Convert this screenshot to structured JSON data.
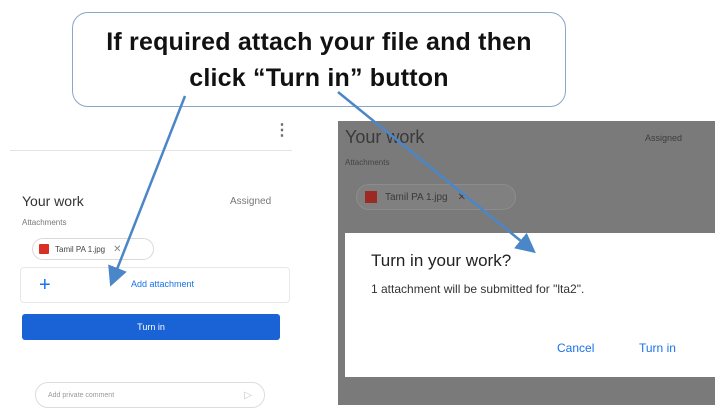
{
  "callout": {
    "line1": "If required attach your file and then",
    "line2": "click “Turn in” button"
  },
  "left": {
    "menu_icon": "⋮",
    "your_work": "Your work",
    "status": "Assigned",
    "attachments_label": "Attachments",
    "file_name": "Tamil PA 1.jpg",
    "add_plus": "+",
    "add_attachment": "Add attachment",
    "turn_in": "Turn in",
    "comment_placeholder": "Add private comment"
  },
  "right": {
    "your_work": "Your work",
    "status": "Assigned",
    "attachments_label": "Attachments",
    "file_name": "Tamil PA 1.jpg",
    "dialog": {
      "title": "Turn in your work?",
      "body": "1 attachment will be submitted for \"lta2\".",
      "cancel": "Cancel",
      "turn_in": "Turn in"
    }
  },
  "colors": {
    "accent": "#1a73e8",
    "button": "#1a63d6",
    "arrow": "#4a86c8",
    "file_icon": "#d93025"
  }
}
